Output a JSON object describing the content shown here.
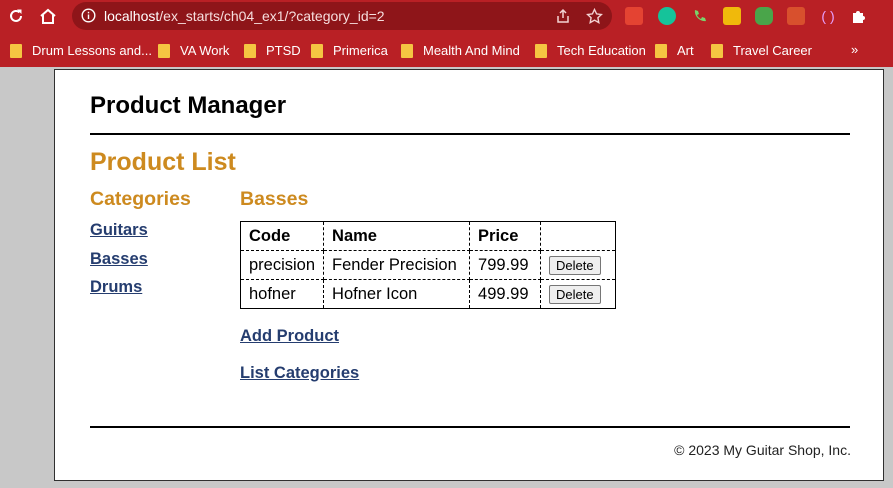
{
  "browser": {
    "url_host": "localhost",
    "url_path": "/ex_starts/ch04_ex1/?category_id=2",
    "bookmarks": [
      "Drum Lessons and...",
      "VA Work",
      "PTSD",
      "Primerica",
      "Mealth And Mind",
      "Tech Education",
      "Art",
      "Travel Career"
    ],
    "more_bookmarks": "»",
    "extension_icons": [
      "todoist-icon",
      "grammarly-icon",
      "phone-icon",
      "binance-icon",
      "robot-icon",
      "pdf-icon",
      "parentheses-icon",
      "puzzle-icon"
    ],
    "colors": {
      "toolbar": "#b92025",
      "omnibox": "#8e1519"
    }
  },
  "page": {
    "title": "Product Manager",
    "heading": "Product List",
    "categories_heading": "Categories",
    "categories": [
      "Guitars",
      "Basses",
      "Drums"
    ],
    "current_category": "Basses",
    "table": {
      "headers": {
        "code": "Code",
        "name": "Name",
        "price": "Price",
        "action": ""
      },
      "rows": [
        {
          "code": "precision",
          "name": "Fender Precision",
          "price": "799.99",
          "action": "Delete"
        },
        {
          "code": "hofner",
          "name": "Hofner Icon",
          "price": "499.99",
          "action": "Delete"
        }
      ]
    },
    "add_product": "Add Product",
    "list_categories": "List Categories",
    "footer": "© 2023 My Guitar Shop, Inc.",
    "colors": {
      "heading": "#cd8a1f",
      "link": "#253d6f"
    }
  }
}
